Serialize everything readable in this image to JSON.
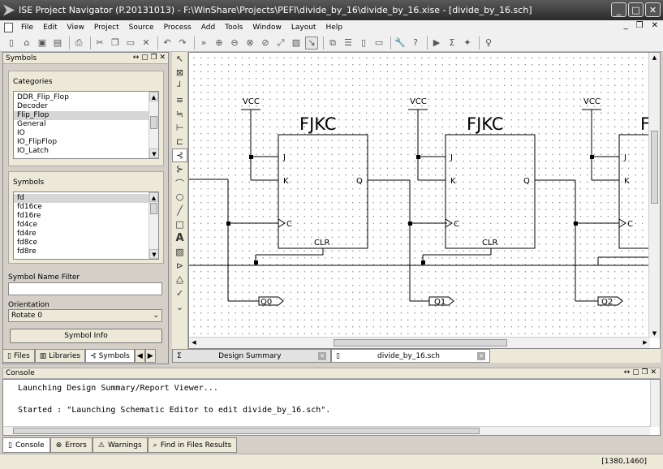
{
  "window": {
    "title": "ISE Project Navigator (P.20131013) - F:\\WinShare\\Projects\\PEFI\\divide_by_16\\divide_by_16.xise - [divide_by_16.sch]"
  },
  "menu": [
    "File",
    "Edit",
    "View",
    "Project",
    "Source",
    "Process",
    "Add",
    "Tools",
    "Window",
    "Layout",
    "Help"
  ],
  "symbols_panel": {
    "header": "Symbols",
    "categories_label": "Categories",
    "categories": [
      "DDR_Flip_Flop",
      "Decoder",
      "Flip_Flop",
      "General",
      "IO",
      "IO_FlipFlop",
      "IO_Latch"
    ],
    "categories_selected": "Flip_Flop",
    "symbols_label": "Symbols",
    "symbols": [
      "fd",
      "fd16ce",
      "fd16re",
      "fd4ce",
      "fd4re",
      "fd8ce",
      "fd8re"
    ],
    "symbols_selected": "fd",
    "filter_label": "Symbol Name Filter",
    "filter_value": "",
    "orientation_label": "Orientation",
    "orientation_value": "Rotate 0",
    "info_button": "Symbol Info"
  },
  "left_tabs": [
    "Files",
    "Libraries",
    "Symbols"
  ],
  "schematic": {
    "blocks": [
      {
        "name": "FJKC",
        "vcc": "VCC",
        "pin_j": "J",
        "pin_k": "K",
        "pin_c": "C",
        "pin_q": "Q",
        "pin_clr": "CLR",
        "output": "Q0"
      },
      {
        "name": "FJKC",
        "vcc": "VCC",
        "pin_j": "J",
        "pin_k": "K",
        "pin_c": "C",
        "pin_q": "Q",
        "pin_clr": "CLR",
        "output": "Q1"
      },
      {
        "name": "F",
        "vcc": "VCC",
        "pin_j": "J",
        "pin_k": "K",
        "pin_c": "C",
        "pin_q": "",
        "pin_clr": "",
        "output": "Q2"
      }
    ]
  },
  "doc_tabs": [
    "Design Summary",
    "divide_by_16.sch"
  ],
  "console": {
    "header": "Console",
    "lines": [
      "Launching Design Summary/Report Viewer...",
      "Started : \"Launching Schematic Editor to edit divide_by_16.sch\"."
    ]
  },
  "bottom_tabs": [
    "Console",
    "Errors",
    "Warnings",
    "Find in Files Results"
  ],
  "status": {
    "coords": "[1380,1460]"
  }
}
